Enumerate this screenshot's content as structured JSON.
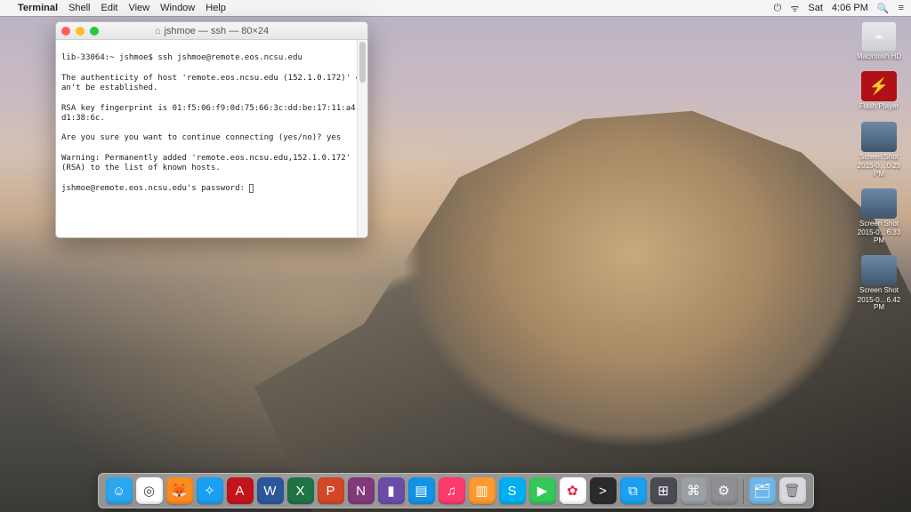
{
  "menubar": {
    "app": "Terminal",
    "items": [
      "Shell",
      "Edit",
      "View",
      "Window",
      "Help"
    ],
    "right": {
      "day": "Sat",
      "time": "4:06 PM"
    }
  },
  "terminal": {
    "title": "jshmoe — ssh — 80×24",
    "lines": [
      "lib-33064:~ jshmoe$ ssh jshmoe@remote.eos.ncsu.edu",
      "The authenticity of host 'remote.eos.ncsu.edu (152.1.0.172)' can't be established.",
      "RSA key fingerprint is 01:f5:06:f9:0d:75:66:3c:dd:be:17:11:a4:d1:38:6c.",
      "Are you sure you want to continue connecting (yes/no)? yes",
      "Warning: Permanently added 'remote.eos.ncsu.edu,152.1.0.172' (RSA) to the list of known hosts.",
      "jshmoe@remote.eos.ncsu.edu's password: "
    ]
  },
  "desktop_icons": [
    {
      "name": "macintosh-hd",
      "label": "Macintosh HD",
      "sub": "",
      "kind": "hd"
    },
    {
      "name": "flash-player",
      "label": "Flash Player",
      "sub": "",
      "kind": "fp"
    },
    {
      "name": "screenshot-1",
      "label": "Screen Shot",
      "sub": "2015-0…0.29 PM",
      "kind": "ss"
    },
    {
      "name": "screenshot-2",
      "label": "Screen Shot",
      "sub": "2015-0…6.33 PM",
      "kind": "ss"
    },
    {
      "name": "screenshot-3",
      "label": "Screen Shot",
      "sub": "2015-0…6.42 PM",
      "kind": "ss"
    }
  ],
  "dock": [
    {
      "name": "finder",
      "bg": "#2aa7ef",
      "glyph": "☺"
    },
    {
      "name": "chrome",
      "bg": "#ffffff",
      "glyph": "◎",
      "fg": "#444"
    },
    {
      "name": "firefox",
      "bg": "#ff8b1f",
      "glyph": "🦊"
    },
    {
      "name": "safari",
      "bg": "#1a9ff1",
      "glyph": "✧"
    },
    {
      "name": "acrobat",
      "bg": "#c3131c",
      "glyph": "A"
    },
    {
      "name": "word",
      "bg": "#2b579a",
      "glyph": "W"
    },
    {
      "name": "excel",
      "bg": "#217346",
      "glyph": "X"
    },
    {
      "name": "powerpoint",
      "bg": "#d24726",
      "glyph": "P"
    },
    {
      "name": "onenote",
      "bg": "#80397b",
      "glyph": "N"
    },
    {
      "name": "app-purple",
      "bg": "#6b4da8",
      "glyph": "▮"
    },
    {
      "name": "keynote",
      "bg": "#1293e6",
      "glyph": "▤"
    },
    {
      "name": "itunes",
      "bg": "#fc3a6d",
      "glyph": "♫"
    },
    {
      "name": "ibooks",
      "bg": "#ff9a2e",
      "glyph": "▥"
    },
    {
      "name": "skype",
      "bg": "#00aff0",
      "glyph": "S"
    },
    {
      "name": "facetime",
      "bg": "#34c759",
      "glyph": "▶"
    },
    {
      "name": "photos",
      "bg": "#ffffff",
      "glyph": "✿",
      "fg": "#e24"
    },
    {
      "name": "terminal",
      "bg": "#2b2b2b",
      "glyph": ">"
    },
    {
      "name": "preview",
      "bg": "#1a9ff1",
      "glyph": "⧉"
    },
    {
      "name": "mission",
      "bg": "#4b4b55",
      "glyph": "⊞"
    },
    {
      "name": "launchpad",
      "bg": "#9aa0a6",
      "glyph": "⌘"
    },
    {
      "name": "settings",
      "bg": "#8e8e93",
      "glyph": "⚙"
    },
    {
      "name": "folder",
      "bg": "#6fb7e9",
      "glyph": "🗂"
    },
    {
      "name": "trash",
      "bg": "#d9d9de",
      "glyph": "🗑",
      "fg": "#666"
    }
  ]
}
